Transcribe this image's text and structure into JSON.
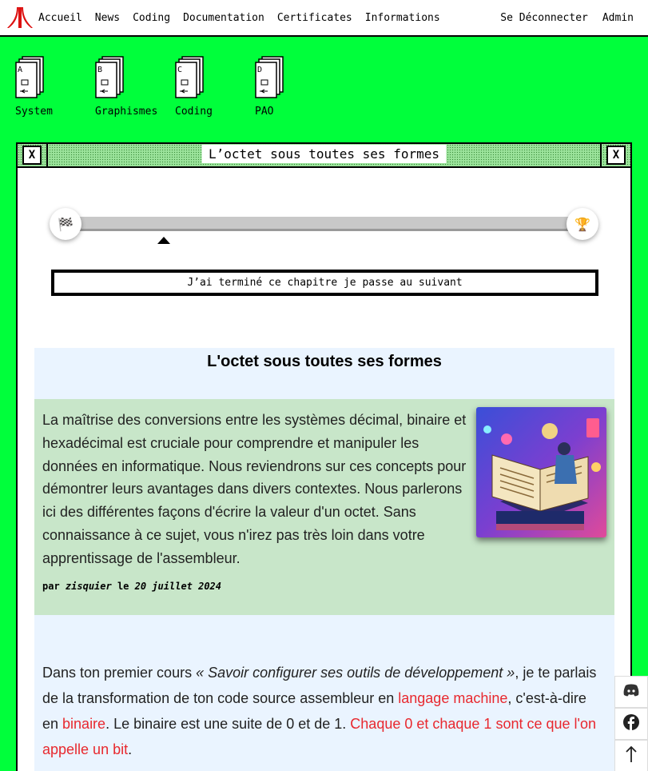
{
  "menubar": {
    "left": [
      "Accueil",
      "News",
      "Coding",
      "Documentation",
      "Certificates",
      "Informations"
    ],
    "right": [
      "Se Déconnecter",
      "Admin"
    ]
  },
  "desktop": [
    {
      "letter": "A",
      "label": "System"
    },
    {
      "letter": "B",
      "label": "Graphismes"
    },
    {
      "letter": "C",
      "label": "Coding"
    },
    {
      "letter": "D",
      "label": "PAO"
    }
  ],
  "window": {
    "title": "L’octet sous toutes ses formes",
    "close_glyph": "X",
    "full_glyph": "X"
  },
  "progress": {
    "start_icon": "🏁",
    "end_icon": "🏆",
    "done_label": "J’ai terminé ce chapitre je passe au suivant"
  },
  "article": {
    "title": "L'octet sous toutes ses formes",
    "intro": "La maîtrise des conversions entre les systèmes décimal, binaire et hexadécimal est cruciale pour comprendre et manipuler les données en informatique. Nous reviendrons sur ces concepts pour démontrer leurs avantages dans divers contextes. Nous parlerons ici des différentes façons d'écrire la valeur d'un octet. Sans connaissance à ce sujet, vous n'irez pas très loin dans votre apprentissage de l'assembleur.",
    "byline_par": "par",
    "author": "zisquier",
    "byline_le": "le",
    "date": "20 juillet 2024",
    "body": {
      "p1": "Dans ton premier cours ",
      "p2": "« Savoir configurer ses outils de développement »",
      "p3": ", je te parlais de la transformation de ton code source assembleur en ",
      "link1": "langage machine",
      "p4": ", c'est-à-dire en ",
      "link2": "binaire",
      "p5": ". Le binaire est une suite de 0 et de 1. ",
      "link3": "Chaque 0 et chaque 1 sont ce que l'on appelle un bit",
      "p6": "."
    }
  },
  "side_buttons": [
    "discord-icon",
    "facebook-icon",
    "arrow-up-icon"
  ],
  "colors": {
    "desktop": "#00ff3b",
    "link": "#e8282e",
    "intro_bg": "#c8e6c9",
    "article_bg": "#eaf4ff"
  }
}
